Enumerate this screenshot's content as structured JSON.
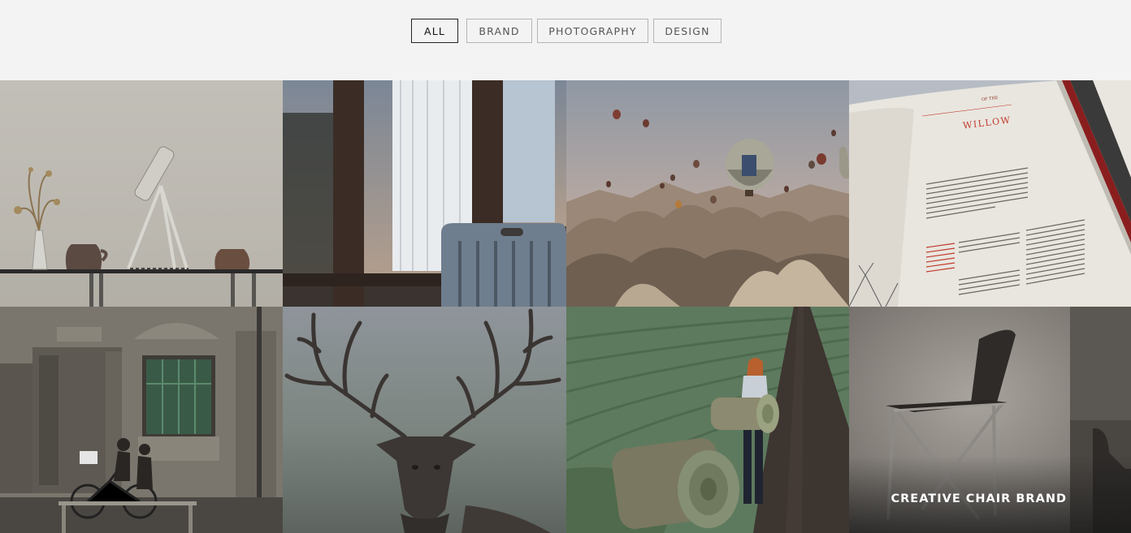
{
  "filters": {
    "all": "ALL",
    "brand": "BRAND",
    "photography": "PHOTOGRAPHY",
    "design": "DESIGN",
    "active": "ALL"
  },
  "book": {
    "heading_small": "OF THE",
    "heading_title": "WILLOW"
  },
  "portfolio": {
    "hover_caption": "CREATIVE CHAIR BRAND"
  },
  "colors": {
    "page_background": "#f3f3f3",
    "active_border": "#222222",
    "inactive_border": "#b5b5b5",
    "book_accent": "#c0392b"
  }
}
